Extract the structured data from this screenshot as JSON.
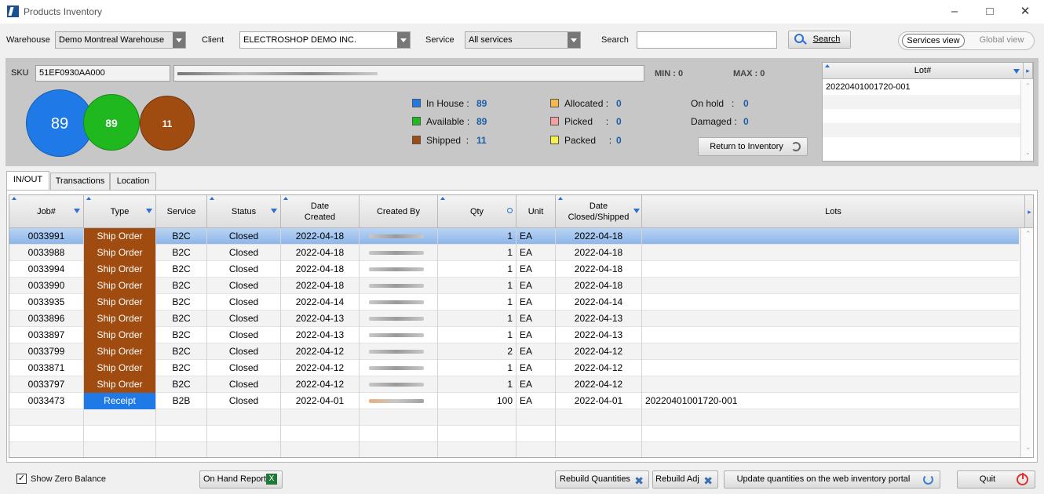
{
  "window": {
    "title": "Products Inventory"
  },
  "toolbar": {
    "warehouse_label": "Warehouse",
    "warehouse_value": "Demo Montreal Warehouse",
    "client_label": "Client",
    "client_value": "ELECTROSHOP DEMO INC.",
    "service_label": "Service",
    "service_value": "All services",
    "search_label": "Search",
    "search_value": "",
    "search_button": "Search",
    "services_view": "Services view",
    "global_view": "Global view"
  },
  "sku": {
    "label": "SKU",
    "value": "51EF0930AA000",
    "min_label": "MIN :",
    "min_value": "0",
    "max_label": "MAX :",
    "max_value": "0",
    "circles": {
      "in_house": "89",
      "available": "89",
      "shipped": "11"
    },
    "stats": [
      {
        "label": "In House :",
        "value": "89",
        "color": "#1f7ae8"
      },
      {
        "label": "Available :",
        "value": "89",
        "color": "#1fb81f"
      },
      {
        "label": "Shipped  :",
        "value": "11",
        "color": "#a04c10"
      },
      {
        "label": "Allocated :",
        "value": "0",
        "color": "#f7b84a"
      },
      {
        "label": "Picked     :",
        "value": "0",
        "color": "#f2a0a0"
      },
      {
        "label": "Packed     :",
        "value": "0",
        "color": "#f7f04a"
      },
      {
        "label": "On hold   :",
        "value": "0"
      },
      {
        "label": "Damaged :",
        "value": "0"
      }
    ],
    "return_button": "Return to Inventory",
    "lot_header": "Lot#",
    "lots": [
      "20220401001720-001"
    ]
  },
  "tabs": [
    "IN/OUT",
    "Transactions",
    "Location"
  ],
  "grid": {
    "columns": [
      "Job#",
      "Type",
      "Service",
      "Status",
      "Date Created",
      "Created By",
      "Qty",
      "Unit",
      "Date Closed/Shipped",
      "Lots"
    ],
    "date_created_1": "Date",
    "date_created_2": "Created",
    "date_closed_1": "Date",
    "date_closed_2": "Closed/Shipped",
    "rows": [
      {
        "job": "0033991",
        "type": "Ship Order",
        "service": "B2C",
        "status": "Closed",
        "created": "2022-04-18",
        "qty": "1",
        "unit": "EA",
        "closed": "2022-04-18",
        "lots": ""
      },
      {
        "job": "0033988",
        "type": "Ship Order",
        "service": "B2C",
        "status": "Closed",
        "created": "2022-04-18",
        "qty": "1",
        "unit": "EA",
        "closed": "2022-04-18",
        "lots": ""
      },
      {
        "job": "0033994",
        "type": "Ship Order",
        "service": "B2C",
        "status": "Closed",
        "created": "2022-04-18",
        "qty": "1",
        "unit": "EA",
        "closed": "2022-04-18",
        "lots": ""
      },
      {
        "job": "0033990",
        "type": "Ship Order",
        "service": "B2C",
        "status": "Closed",
        "created": "2022-04-18",
        "qty": "1",
        "unit": "EA",
        "closed": "2022-04-18",
        "lots": ""
      },
      {
        "job": "0033935",
        "type": "Ship Order",
        "service": "B2C",
        "status": "Closed",
        "created": "2022-04-14",
        "qty": "1",
        "unit": "EA",
        "closed": "2022-04-14",
        "lots": ""
      },
      {
        "job": "0033896",
        "type": "Ship Order",
        "service": "B2C",
        "status": "Closed",
        "created": "2022-04-13",
        "qty": "1",
        "unit": "EA",
        "closed": "2022-04-13",
        "lots": ""
      },
      {
        "job": "0033897",
        "type": "Ship Order",
        "service": "B2C",
        "status": "Closed",
        "created": "2022-04-13",
        "qty": "1",
        "unit": "EA",
        "closed": "2022-04-13",
        "lots": ""
      },
      {
        "job": "0033799",
        "type": "Ship Order",
        "service": "B2C",
        "status": "Closed",
        "created": "2022-04-12",
        "qty": "2",
        "unit": "EA",
        "closed": "2022-04-12",
        "lots": ""
      },
      {
        "job": "0033871",
        "type": "Ship Order",
        "service": "B2C",
        "status": "Closed",
        "created": "2022-04-12",
        "qty": "1",
        "unit": "EA",
        "closed": "2022-04-12",
        "lots": ""
      },
      {
        "job": "0033797",
        "type": "Ship Order",
        "service": "B2C",
        "status": "Closed",
        "created": "2022-04-12",
        "qty": "1",
        "unit": "EA",
        "closed": "2022-04-12",
        "lots": ""
      },
      {
        "job": "0033473",
        "type": "Receipt",
        "service": "B2B",
        "status": "Closed",
        "created": "2022-04-01",
        "qty": "100",
        "unit": "EA",
        "closed": "2022-04-01",
        "lots": "20220401001720-001"
      }
    ]
  },
  "bottom": {
    "show_zero": "Show Zero Balance",
    "on_hand": "On Hand Report",
    "rebuild_qty": "Rebuild Quantities",
    "rebuild_adj": "Rebuild Adj",
    "update_portal": "Update quantities on the web inventory portal",
    "quit": "Quit"
  }
}
